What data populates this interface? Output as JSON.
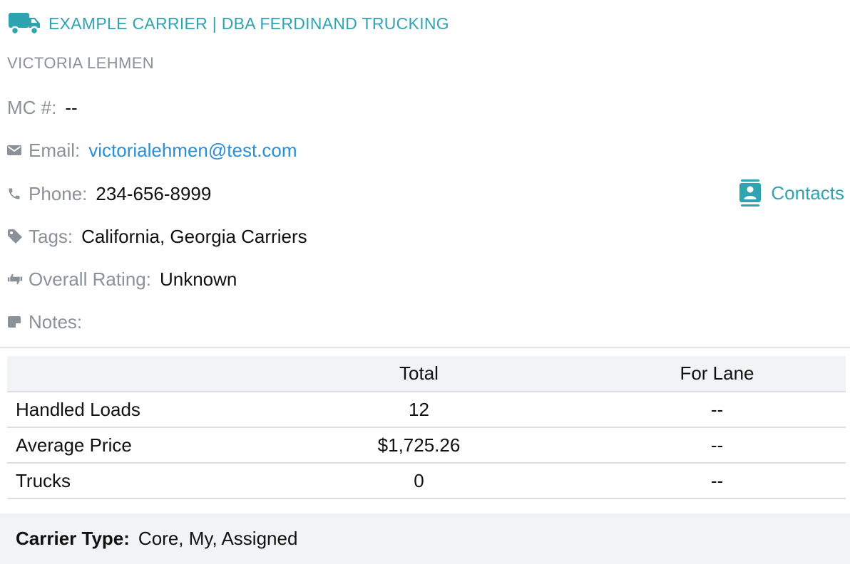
{
  "header": {
    "carrier_name": "EXAMPLE CARRIER | DBA FERDINAND TRUCKING",
    "icon": "truck-icon"
  },
  "contact": {
    "name": "VICTORIA LEHMEN"
  },
  "fields": {
    "mc": {
      "label": "MC #:",
      "value": "--"
    },
    "email": {
      "label": "Email:",
      "value": "victorialehmen@test.com",
      "icon": "envelope-icon"
    },
    "phone": {
      "label": "Phone:",
      "value": "234-656-8999",
      "icon": "phone-icon"
    },
    "tags": {
      "label": "Tags:",
      "value": "California, Georgia Carriers",
      "icon": "tag-icon"
    },
    "rating": {
      "label": "Overall Rating:",
      "value": "Unknown",
      "icon": "thumbs-icon"
    },
    "notes": {
      "label": "Notes:",
      "value": "",
      "icon": "note-icon"
    }
  },
  "contacts_button": {
    "label": "Contacts",
    "icon": "contact-book-icon"
  },
  "stats_table": {
    "headers": [
      "",
      "Total",
      "For Lane"
    ],
    "rows": [
      {
        "label": "Handled Loads",
        "total": "12",
        "lane": "--"
      },
      {
        "label": "Average Price",
        "total": "$1,725.26",
        "lane": "--"
      },
      {
        "label": "Trucks",
        "total": "0",
        "lane": "--"
      }
    ]
  },
  "carrier_type": {
    "label": "Carrier Type:",
    "value": "Core, My, Assigned"
  },
  "colors": {
    "accent_teal": "#2fa4b0",
    "link_blue": "#2a8fd6",
    "label_gray": "#8a9198",
    "header_bg": "#f2f3f4"
  }
}
